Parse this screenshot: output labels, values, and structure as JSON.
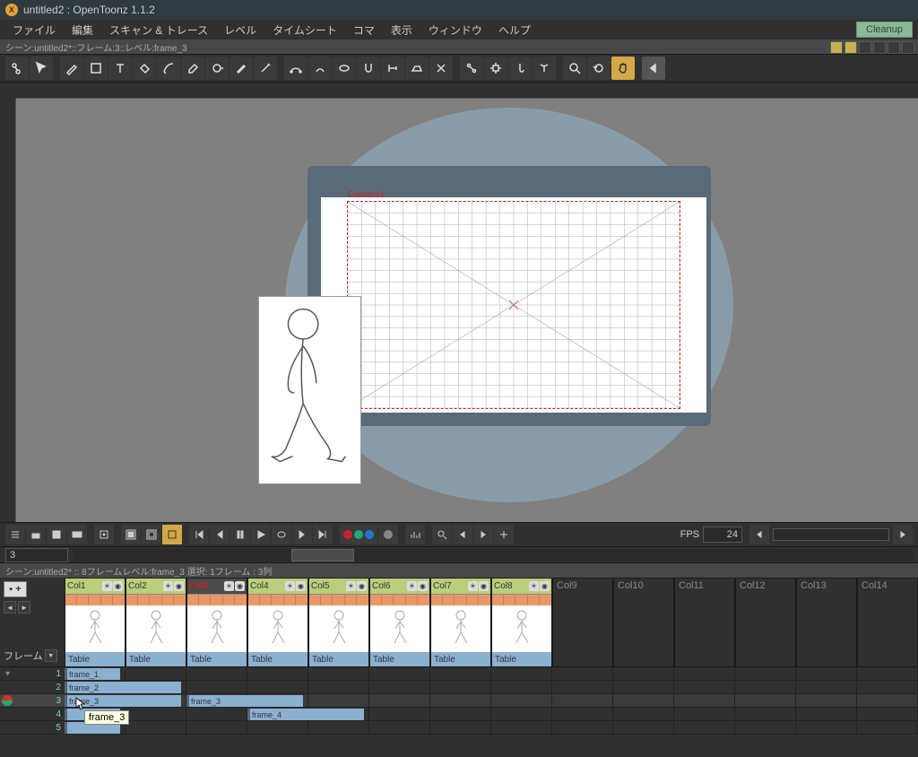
{
  "titlebar": {
    "title": "untitled2 : OpenToonz 1.1.2"
  },
  "menu": {
    "items": [
      "ファイル",
      "編集",
      "スキャン & トレース",
      "レベル",
      "タイムシート",
      "コマ",
      "表示",
      "ウィンドウ",
      "ヘルプ"
    ],
    "cleanup": "Cleanup"
  },
  "status1": "シーン:untitled2*::フレーム:3::レベル:frame_3",
  "viewer": {
    "camera_label": "Camera1"
  },
  "playback": {
    "fps_label": "FPS",
    "fps_value": "24",
    "frame_number": "3",
    "colors": [
      "#c23",
      "#2a7",
      "#27c"
    ]
  },
  "xsheet_status": "シーン:untitled2*  ::  8フレームレベル:frame_3  選択: 1フレーム : 3列",
  "columns": {
    "frame_label": "フレーム",
    "headers": [
      {
        "name": "Col1",
        "foot": "Table"
      },
      {
        "name": "Col2",
        "foot": "Table"
      },
      {
        "name": "Col3",
        "foot": "Table",
        "selected": true
      },
      {
        "name": "Col4",
        "foot": "Table"
      },
      {
        "name": "Col5",
        "foot": "Table"
      },
      {
        "name": "Col6",
        "foot": "Table"
      },
      {
        "name": "Col7",
        "foot": "Table"
      },
      {
        "name": "Col8",
        "foot": "Table"
      }
    ],
    "empty": [
      "Col9",
      "Col10",
      "Col11",
      "Col12",
      "Col13",
      "Col14"
    ]
  },
  "timeline": {
    "rows": [
      1,
      2,
      3,
      4,
      5
    ],
    "current_row": 3,
    "clips": [
      {
        "row": 1,
        "col": 0,
        "span": 1,
        "label": "frame_1"
      },
      {
        "row": 2,
        "col": 0,
        "span": 2,
        "label": "frame_2"
      },
      {
        "row": 3,
        "col": 0,
        "span": 2,
        "label": "frame_3"
      },
      {
        "row": 3,
        "col": 2,
        "span": 2,
        "label": "frame_3"
      },
      {
        "row": 4,
        "col": 0,
        "span": 1,
        "label": ""
      },
      {
        "row": 4,
        "col": 3,
        "span": 2,
        "label": "frame_4"
      },
      {
        "row": 5,
        "col": 0,
        "span": 1,
        "label": ""
      }
    ],
    "tooltip": "frame_3"
  }
}
